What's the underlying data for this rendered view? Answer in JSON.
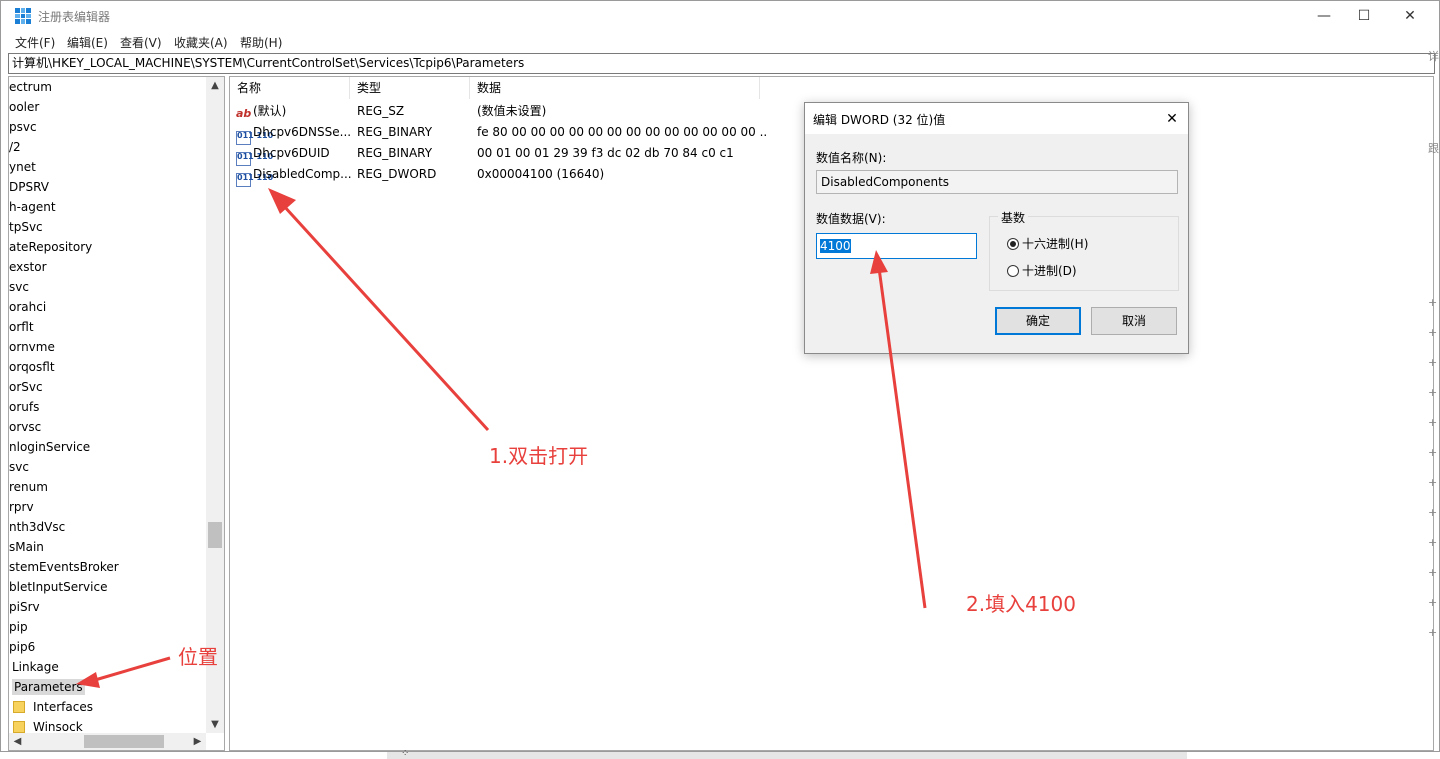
{
  "window": {
    "title": "注册表编辑器",
    "buttons": {
      "minimize": "—",
      "maximize": "☐",
      "close": "✕"
    }
  },
  "menu": [
    "文件(F)",
    "编辑(E)",
    "查看(V)",
    "收藏夹(A)",
    "帮助(H)"
  ],
  "address": "计算机\\HKEY_LOCAL_MACHINE\\SYSTEM\\CurrentControlSet\\Services\\Tcpip6\\Parameters",
  "tree": {
    "items": [
      "ectrum",
      "ooler",
      "psvc",
      "/2",
      "ynet",
      "DPSRV",
      "h-agent",
      "tpSvc",
      "ateRepository",
      "exstor",
      "svc",
      "orahci",
      "orflt",
      "ornvme",
      "orqosflt",
      "orSvc",
      "orufs",
      "orvsc",
      "nloginService",
      "svc",
      "renum",
      "rprv",
      "nth3dVsc",
      "sMain",
      "stemEventsBroker",
      "bletInputService",
      "piSrv",
      "pip",
      "pip6",
      "Linkage",
      "Parameters",
      "Interfaces",
      "Winsock"
    ],
    "selected": "Parameters",
    "folder_items": [
      "Interfaces",
      "Winsock"
    ]
  },
  "list": {
    "columns": [
      "名称",
      "类型",
      "数据"
    ],
    "rows": [
      {
        "icon": "string-value-icon",
        "name": "(默认)",
        "type": "REG_SZ",
        "data": "(数值未设置)"
      },
      {
        "icon": "binary-value-icon",
        "name": "Dhcpv6DNSSe...",
        "type": "REG_BINARY",
        "data": "fe 80 00 00 00 00 00 00 00 00 00 00 00 00 00 ..."
      },
      {
        "icon": "binary-value-icon",
        "name": "Dhcpv6DUID",
        "type": "REG_BINARY",
        "data": "00 01 00 01 29 39 f3 dc 02 db 70 84 c0 c1"
      },
      {
        "icon": "binary-value-icon",
        "name": "DisabledComp...",
        "type": "REG_DWORD",
        "data": "0x00004100 (16640)"
      }
    ]
  },
  "dialog": {
    "title": "编辑 DWORD (32 位)值",
    "close": "✕",
    "name_label": "数值名称(N):",
    "name_value": "DisabledComponents",
    "data_label": "数值数据(V):",
    "data_value": "4100",
    "base_label": "基数",
    "base_options": [
      "十六进制(H)",
      "十进制(D)"
    ],
    "base_selected": "十六进制(H)",
    "ok": "确定",
    "cancel": "取消"
  },
  "annotations": {
    "step1": "1.双击打开",
    "step2": "2.填入4100",
    "location": "位置",
    "color": "#e8403c"
  },
  "right_edge_glyphs": [
    "详",
    "跟",
    "+",
    "+",
    "+",
    "+",
    "+",
    "+",
    "+",
    "+",
    "+",
    "+",
    "+",
    "+"
  ],
  "bottom_glyph": "⁘"
}
